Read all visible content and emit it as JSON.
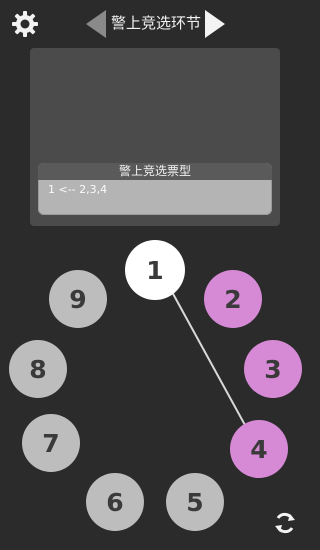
{
  "header": {
    "phase_title": "警上竞选环节"
  },
  "vote_panel": {
    "title": "警上竞选票型",
    "content": "1 <-- 2,3,4"
  },
  "seats": [
    {
      "number": "1",
      "state": "white"
    },
    {
      "number": "2",
      "state": "pink"
    },
    {
      "number": "3",
      "state": "pink"
    },
    {
      "number": "4",
      "state": "pink"
    },
    {
      "number": "5",
      "state": "grey"
    },
    {
      "number": "6",
      "state": "grey"
    },
    {
      "number": "7",
      "state": "grey"
    },
    {
      "number": "8",
      "state": "grey"
    },
    {
      "number": "9",
      "state": "grey"
    }
  ],
  "colors": {
    "background": "#2b2b2b",
    "panel": "#4b4b4b",
    "seat_grey": "#bdbdbd",
    "seat_pink": "#d68ad6",
    "seat_white": "#ffffff"
  },
  "icons": {
    "settings": "gear-icon",
    "previous": "left-arrow-icon",
    "next": "right-arrow-icon",
    "refresh": "refresh-icon"
  }
}
